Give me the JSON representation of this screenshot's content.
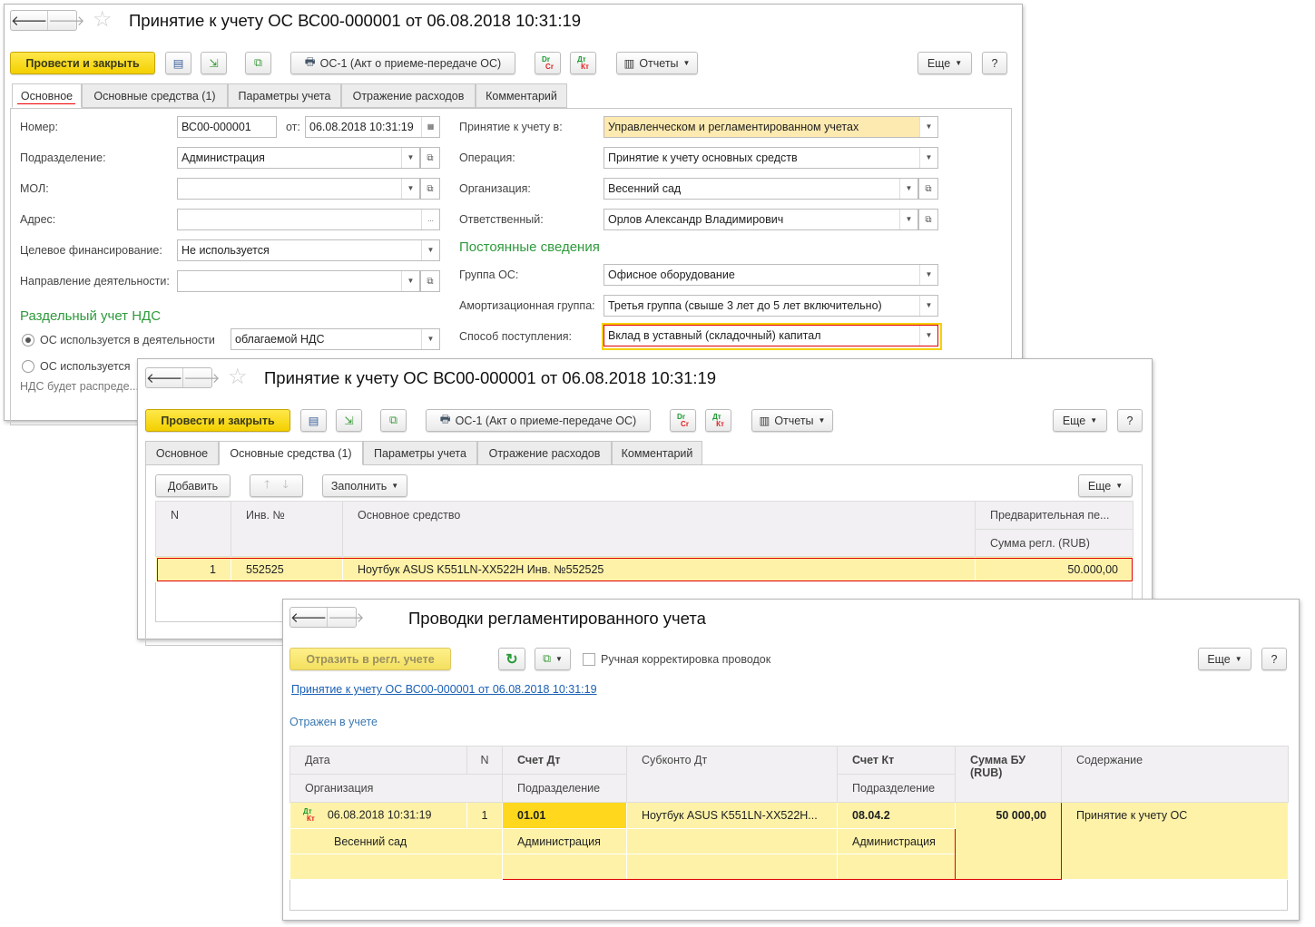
{
  "doc_window": {
    "title": "Принятие к учету ОС ВС00-000001 от 06.08.2018 10:31:19",
    "post_close": "Провести и закрыть",
    "print_btn": "ОС-1 (Акт о приеме-передаче ОС)",
    "reports": "Отчеты",
    "more": "Еще",
    "help": "?",
    "dr": "Dr",
    "cr": "Cr",
    "dt": "Дт",
    "kt": "Кт",
    "tabs": [
      "Основное",
      "Основные средства (1)",
      "Параметры учета",
      "Отражение расходов",
      "Комментарий"
    ],
    "fields": {
      "number_label": "Номер:",
      "number": "ВС00-000001",
      "from_label": "от:",
      "date": "06.08.2018 10:31:19",
      "division_label": "Подразделение:",
      "division": "Администрация",
      "mol_label": "МОЛ:",
      "mol": "",
      "address_label": "Адрес:",
      "address": "",
      "address_btn": "...",
      "target_fin_label": "Целевое финансирование:",
      "target_fin": "Не используется",
      "direction_label": "Направление деятельности:",
      "direction": "",
      "accept_in_label": "Принятие к учету в:",
      "accept_in": "Управленческом и регламентированном учетах",
      "operation_label": "Операция:",
      "operation": "Принятие к учету основных средств",
      "org_label": "Организация:",
      "org": "Весенний сад",
      "responsible_label": "Ответственный:",
      "responsible": "Орлов Александр Владимирович",
      "permanent_heading": "Постоянные сведения",
      "group_label": "Группа ОС:",
      "group": "Офисное оборудование",
      "amort_label": "Амортизационная группа:",
      "amort": "Третья группа (свыше 3 лет до 5 лет включительно)",
      "receipt_label": "Способ поступления:",
      "receipt": "Вклад в уставный (складочный) капитал",
      "vat_heading": "Раздельный учет НДС",
      "radio1": "ОС используется в деятельности",
      "radio1_value": "облагаемой НДС",
      "radio2": "ОС используется",
      "vat_note": "НДС будет распреде..."
    }
  },
  "assets_window": {
    "title": "Принятие к учету ОС ВС00-000001 от 06.08.2018 10:31:19",
    "add": "Добавить",
    "fill": "Заполнить",
    "more": "Еще",
    "columns": [
      "N",
      "Инв. №",
      "Основное средство",
      "Предварительная пе...",
      "Сумма регл. (RUB)"
    ],
    "rows": [
      {
        "n": "1",
        "inv": "552525",
        "asset": "Ноутбук ASUS K551LN-XX522H Инв. №552525",
        "sum": "50.000,00"
      }
    ]
  },
  "entries_window": {
    "title": "Проводки регламентированного учета",
    "reflect": "Отразить в регл. учете",
    "manual_label": "Ручная корректировка проводок",
    "manual_checked": false,
    "link": "Принятие к учету ОС ВС00-000001 от 06.08.2018 10:31:19",
    "status": "Отражен в учете",
    "more": "Еще",
    "help": "?",
    "columns": {
      "date": "Дата",
      "n": "N",
      "dt": "Счет Дт",
      "sub_dt": "Субконто Дт",
      "kt": "Счет Кт",
      "sum": "Сумма БУ (RUB)",
      "content": "Содержание",
      "org": "Организация",
      "div_dt": "Подразделение",
      "div_kt": "Подразделение"
    },
    "row": {
      "date": "06.08.2018 10:31:19",
      "n": "1",
      "dt": "01.01",
      "sub_dt": "Ноутбук ASUS K551LN-XX522H...",
      "kt": "08.04.2",
      "sum": "50 000,00",
      "content": "Принятие к учету ОС",
      "org": "Весенний сад",
      "div_dt": "Администрация",
      "div_kt": "Администрация"
    }
  },
  "colors": {
    "accent_yellow": "#f3d000",
    "row_highlight": "#fdf2a8",
    "selected_cell": "#ffd81e",
    "heading_green": "#2e9a3c",
    "link_blue": "#1a5fb4",
    "error_red": "#e00000"
  }
}
